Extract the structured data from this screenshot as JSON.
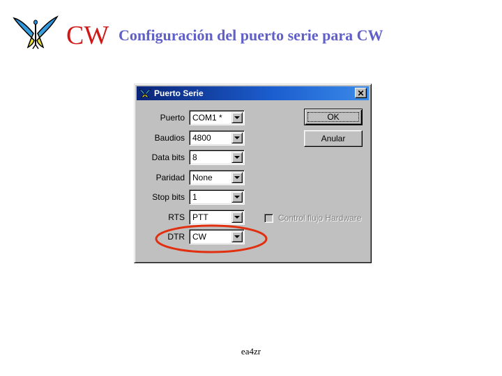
{
  "slide": {
    "brand": "CW",
    "title": "Configuración del puerto serie para CW",
    "footer": "ea4zr",
    "logo_icon": "butterfly-logo-icon"
  },
  "colors": {
    "brand_red": "#d01818",
    "title_blue": "#6060c8",
    "titlebar_start": "#0a2478",
    "titlebar_end": "#3a8ae8",
    "dialog_face": "#c0c0c0",
    "annotation_red": "#e03010"
  },
  "dialog": {
    "title": "Puerto Serie",
    "title_icon": "butterfly-icon",
    "close_icon": "close-icon",
    "close_glyph": "✕",
    "fields": [
      {
        "label": "Puerto",
        "value": "COM1 *"
      },
      {
        "label": "Baudios",
        "value": "4800"
      },
      {
        "label": "Data bits",
        "value": "8"
      },
      {
        "label": "Paridad",
        "value": "None"
      },
      {
        "label": "Stop bits",
        "value": "1"
      },
      {
        "label": "RTS",
        "value": "PTT"
      },
      {
        "label": "DTR",
        "value": "CW"
      }
    ],
    "buttons": {
      "ok": "OK",
      "cancel": "Anular"
    },
    "hardware_flow": {
      "label": "Control flujo Hardware",
      "checked": false,
      "enabled": false
    }
  },
  "annotation": {
    "highlighted_field": "DTR",
    "shape": "ellipse"
  }
}
